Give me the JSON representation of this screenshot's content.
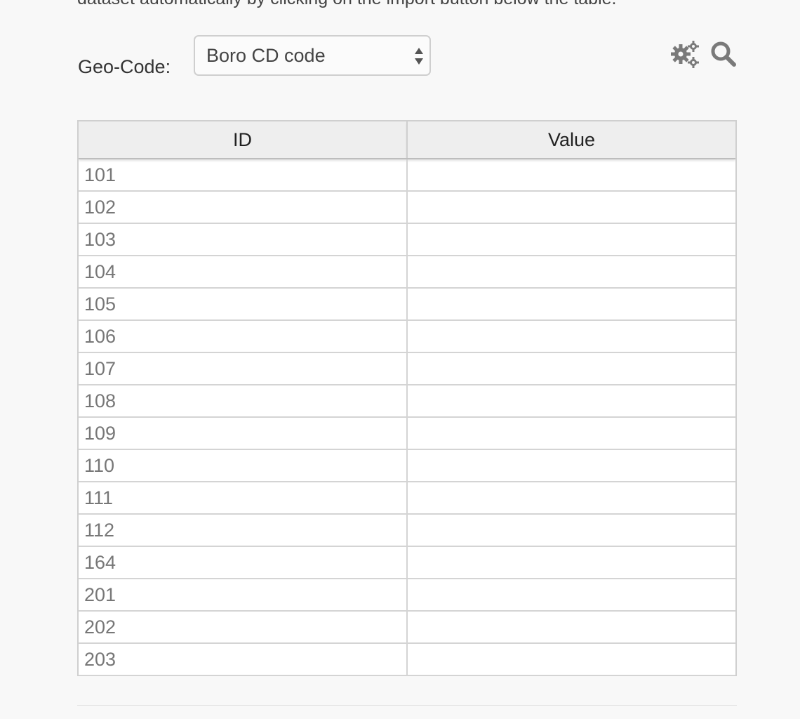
{
  "intro": {
    "text": "dataset automatically by clicking on the import button below the table."
  },
  "geocode": {
    "label": "Geo-Code:",
    "selected": "Boro CD code"
  },
  "toolbar": {
    "settings_icon": "gears-icon",
    "search_icon": "search-icon"
  },
  "table": {
    "headers": [
      "ID",
      "Value"
    ],
    "rows": [
      {
        "id": "101",
        "value": ""
      },
      {
        "id": "102",
        "value": ""
      },
      {
        "id": "103",
        "value": ""
      },
      {
        "id": "104",
        "value": ""
      },
      {
        "id": "105",
        "value": ""
      },
      {
        "id": "106",
        "value": ""
      },
      {
        "id": "107",
        "value": ""
      },
      {
        "id": "108",
        "value": ""
      },
      {
        "id": "109",
        "value": ""
      },
      {
        "id": "110",
        "value": ""
      },
      {
        "id": "111",
        "value": ""
      },
      {
        "id": "112",
        "value": ""
      },
      {
        "id": "164",
        "value": ""
      },
      {
        "id": "201",
        "value": ""
      },
      {
        "id": "202",
        "value": ""
      },
      {
        "id": "203",
        "value": ""
      }
    ]
  },
  "colors": {
    "icon": "#7a7a7a",
    "background": "#f8f8f8",
    "header_bg": "#eeeeee"
  }
}
